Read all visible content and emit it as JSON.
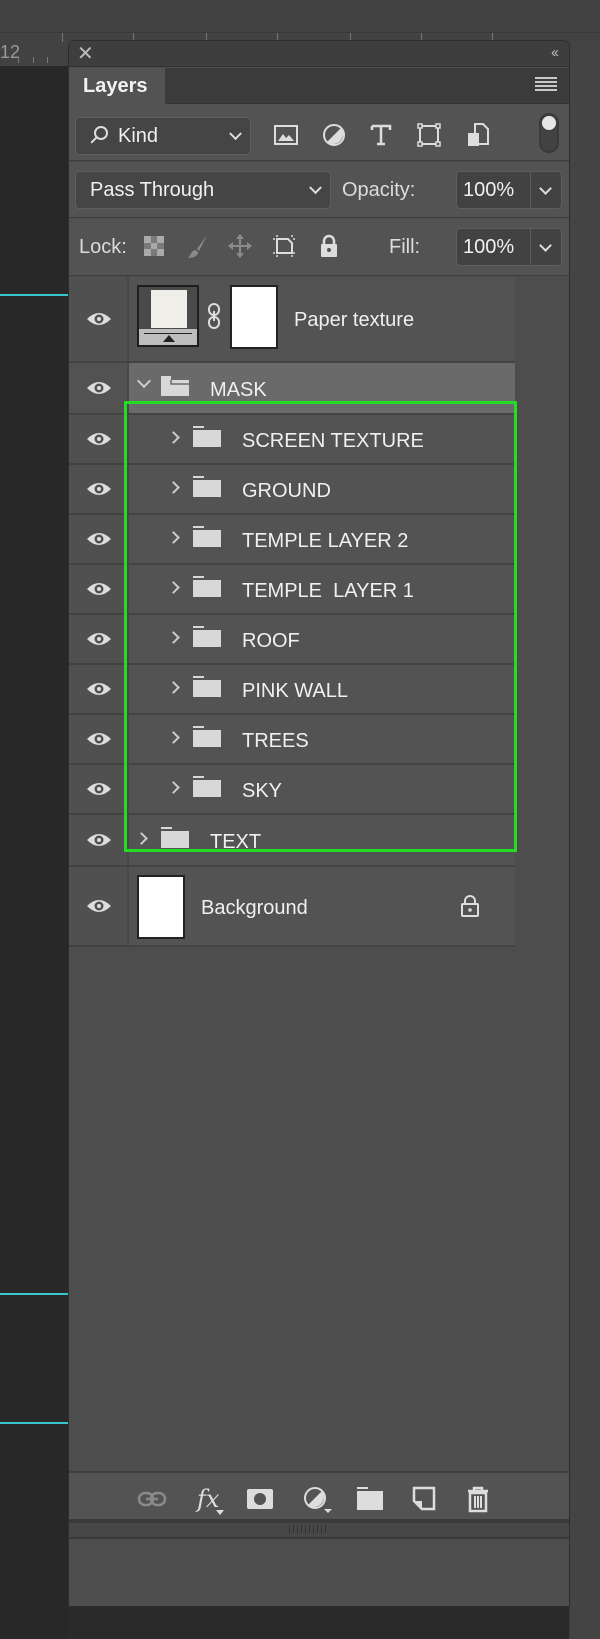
{
  "ruler": {
    "label": "12"
  },
  "panel": {
    "tab_label": "Layers",
    "close_icon": "close-icon",
    "collapse_icon": "double-chevron-left-icon",
    "menu_icon": "hamburger-menu-icon"
  },
  "filter": {
    "kind_label": "Kind",
    "kind_icon": "search-icon",
    "icons": [
      "image-filter-icon",
      "adjustment-filter-icon",
      "type-filter-icon",
      "shape-filter-icon",
      "smart-object-filter-icon"
    ],
    "toggle_on": true
  },
  "blend": {
    "mode": "Pass Through",
    "opacity_label": "Opacity:",
    "opacity_value": "100%"
  },
  "lock": {
    "label": "Lock:",
    "icons": [
      "lock-transparent-pixels-icon",
      "lock-image-pixels-icon",
      "lock-position-icon",
      "lock-artboard-icon",
      "lock-all-icon"
    ],
    "fill_label": "Fill:",
    "fill_value": "100%"
  },
  "layers": [
    {
      "name": "Paper texture",
      "type": "smart-object",
      "visible": true
    },
    {
      "name": "MASK",
      "type": "group",
      "expanded": true,
      "visible": true,
      "selected": true
    },
    {
      "name": "SCREEN TEXTURE",
      "type": "group",
      "visible": true,
      "indent": 1
    },
    {
      "name": "GROUND",
      "type": "group",
      "visible": true,
      "indent": 1
    },
    {
      "name": "TEMPLE LAYER 2",
      "type": "group",
      "visible": true,
      "indent": 1
    },
    {
      "name": "TEMPLE  LAYER 1",
      "type": "group",
      "visible": true,
      "indent": 1
    },
    {
      "name": "ROOF",
      "type": "group",
      "visible": true,
      "indent": 1
    },
    {
      "name": "PINK WALL",
      "type": "group",
      "visible": true,
      "indent": 1
    },
    {
      "name": "TREES",
      "type": "group",
      "visible": true,
      "indent": 1
    },
    {
      "name": "SKY",
      "type": "group",
      "visible": true,
      "indent": 1
    },
    {
      "name": "TEXT",
      "type": "group",
      "visible": true
    },
    {
      "name": "Background",
      "type": "pixel",
      "visible": true,
      "locked": true
    }
  ],
  "highlight_color": "#22dd22",
  "guide_color": "#36c6d0",
  "footer": {
    "icons": [
      "link-layers-icon",
      "fx-icon",
      "add-mask-icon",
      "adjustment-layer-icon",
      "new-group-icon",
      "new-layer-icon",
      "trash-icon"
    ],
    "fx_label": "fx"
  }
}
